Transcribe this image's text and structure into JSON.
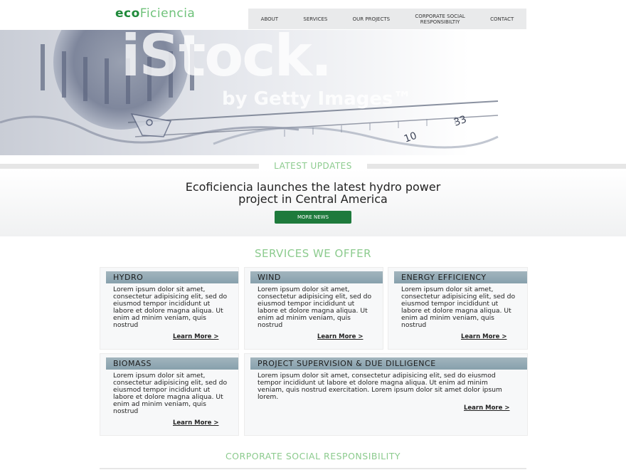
{
  "logo": {
    "part1": "eco",
    "part2": "Ficiencia"
  },
  "nav": {
    "items": [
      "ABOUT",
      "SERVICES",
      "OUR PROJECTS",
      "CORPORATE SOCIAL\nRESPONSIBILTIY",
      "CONTACT"
    ]
  },
  "hero": {
    "watermark_main": "iStock.",
    "watermark_sub": "by Getty Images™",
    "scale_number": "10",
    "scale_number2": "33"
  },
  "updates": {
    "label": "LATEST UPDATES",
    "headline_line1": "Ecoficiencia launches the latest hydro power",
    "headline_line2": "project in Central America",
    "button": "MORE NEWS"
  },
  "services": {
    "title": "SERVICES WE OFFER",
    "cards": [
      {
        "title": "HYDRO",
        "text": "Lorem ipsum dolor sit amet, consectetur adipisicing elit, sed do eiusmod tempor incididunt ut labore et dolore magna aliqua. Ut enim ad minim veniam, quis nostrud",
        "link": "Learn More >"
      },
      {
        "title": "WIND",
        "text": "Lorem ipsum dolor sit amet, consectetur adipisicing elit, sed do eiusmod tempor incididunt ut labore et dolore magna aliqua. Ut enim ad minim veniam, quis nostrud",
        "link": "Learn More >"
      },
      {
        "title": "ENERGY EFFICIENCY",
        "text": "Lorem ipsum dolor sit amet, consectetur adipisicing elit, sed do eiusmod tempor incididunt ut labore et dolore magna aliqua. Ut enim ad minim veniam, quis nostrud",
        "link": "Learn More >"
      },
      {
        "title": "BIOMASS",
        "text": "Lorem ipsum dolor sit amet, consectetur adipisicing elit, sed do eiusmod tempor incididunt ut labore et dolore magna aliqua. Ut enim ad minim veniam, quis nostrud",
        "link": "Learn More >"
      },
      {
        "title": "PROJECT SUPERVISION & DUE DILLIGENCE",
        "text": "Lorem ipsum dolor sit amet, consectetur adipisicing elit, sed do eiusmod tempor incididunt ut labore et dolore magna aliqua. Ut enim ad minim veniam, quis nostrud exercitation. Lorem ipsum dolor sit amet dolor ipsum lorem.",
        "link": "Learn More >"
      }
    ]
  },
  "csr": {
    "title": "CORPORATE SOCIAL RESPONSIBILITY"
  },
  "colors": {
    "brand_green": "#1e7a3c",
    "accent_green": "#8ccb8e",
    "card_header": "#92a9b4"
  }
}
